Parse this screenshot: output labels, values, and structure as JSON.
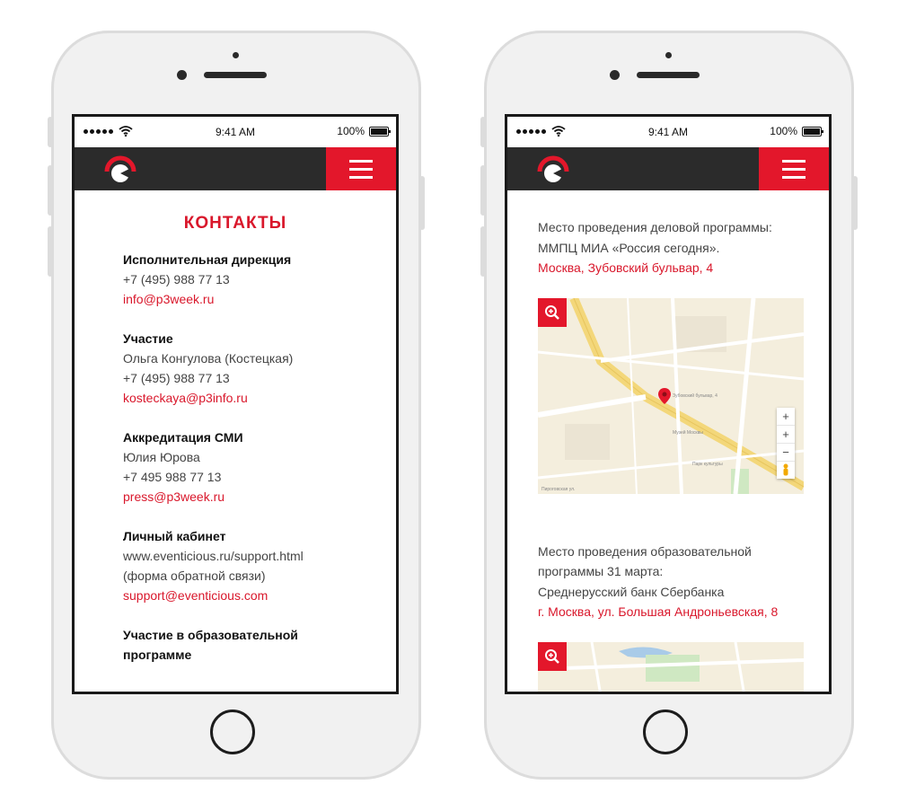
{
  "status_bar": {
    "time": "9:41 AM",
    "battery": "100%"
  },
  "left_screen": {
    "title": "КОНТАКТЫ",
    "contacts": [
      {
        "heading": "Исполнительная дирекция",
        "lines": [
          "+7 (495) 988 77 13"
        ],
        "email": "info@p3week.ru"
      },
      {
        "heading": "Участие",
        "lines": [
          "Ольга Конгулова (Костецкая)",
          "+7 (495) 988 77 13"
        ],
        "email": "kosteckaya@p3info.ru"
      },
      {
        "heading": "Аккредитация СМИ",
        "lines": [
          "Юлия Юрова",
          "+7 495 988 77 13"
        ],
        "email": "press@p3week.ru"
      },
      {
        "heading": "Личный кабинет",
        "lines": [
          "www.eventicious.ru/support.html",
          "(форма обратной связи)"
        ],
        "email": "support@eventicious.com"
      }
    ],
    "partial_heading_1": "Участие в образовательной",
    "partial_heading_2": "программе"
  },
  "right_screen": {
    "venue1": {
      "line1": "Место проведения деловой программы:",
      "line2": "ММПЦ МИА «Россия сегодня».",
      "address": "Москва, Зубовский бульвар, 4",
      "map_labels": [
        "Зубовский бульвар, 4",
        "Музей Москвы",
        "Парк культуры",
        "Пироговская ул."
      ],
      "map_controls": [
        "+",
        "+",
        "−"
      ]
    },
    "venue2": {
      "line1": "Место проведения образовательной",
      "line2": "программы 31 марта:",
      "line3": "Среднерусский банк Сбербанка",
      "address": "г. Москва, ул. Большая Андроньевская, 8"
    }
  },
  "colors": {
    "accent": "#e3172b",
    "navbar": "#2b2b2b",
    "text": "#444444"
  },
  "icons": [
    "signal-dots-icon",
    "wifi-icon",
    "battery-icon",
    "logo-icon",
    "hamburger-menu-icon",
    "zoom-in-icon",
    "map-pin-icon"
  ]
}
